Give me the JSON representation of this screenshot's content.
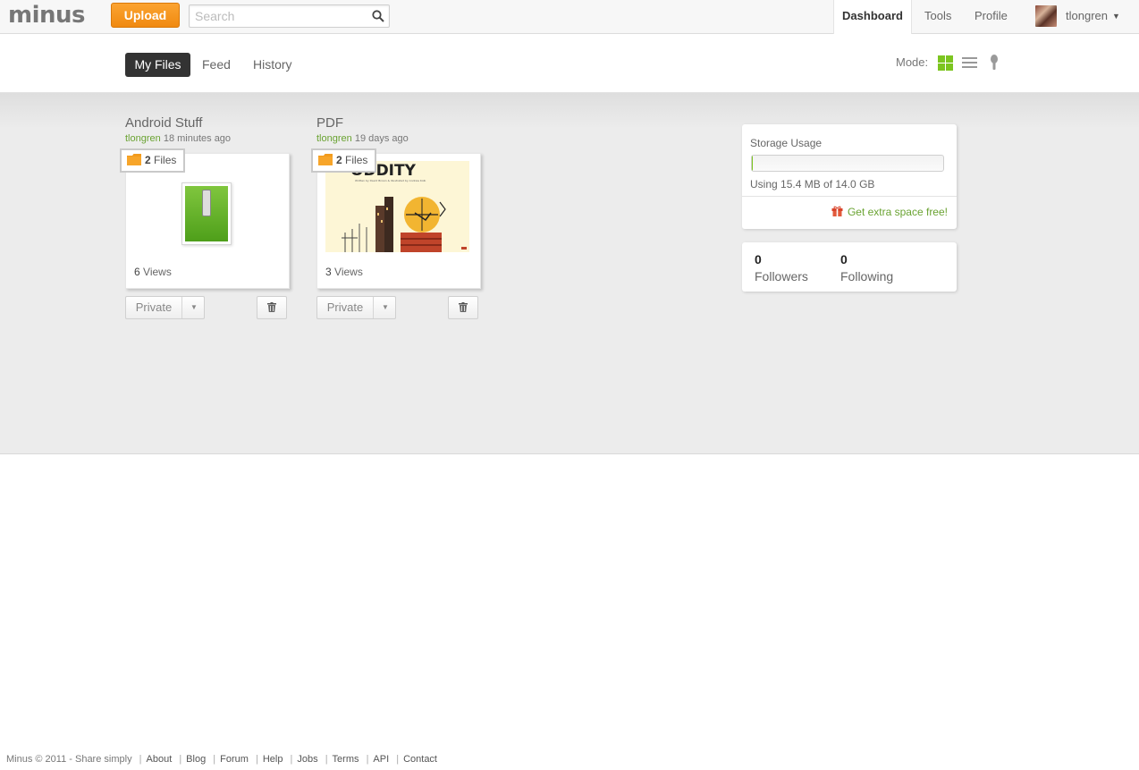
{
  "header": {
    "logo": "minus",
    "upload_label": "Upload",
    "search_placeholder": "Search",
    "nav": {
      "dashboard": "Dashboard",
      "tools": "Tools",
      "profile": "Profile"
    },
    "username": "tlongren"
  },
  "tabs": {
    "my_files": "My Files",
    "feed": "Feed",
    "history": "History"
  },
  "mode": {
    "label": "Mode:",
    "active": "grid",
    "accent": "#7cc520"
  },
  "albums": [
    {
      "title": "Android Stuff",
      "owner": "tlongren",
      "time": "18 minutes ago",
      "file_count": "2",
      "files_label": "Files",
      "views_count": "6",
      "views_label": "Views",
      "privacy": "Private",
      "thumb_icon": "zip-file-icon"
    },
    {
      "title": "PDF",
      "owner": "tlongren",
      "time": "19 days ago",
      "file_count": "2",
      "files_label": "Files",
      "views_count": "3",
      "views_label": "Views",
      "privacy": "Private",
      "thumb_title": "ODDITY",
      "thumb_subtitle": "Written by David Brown & Illustrated by Andrew Kolb",
      "thumb_icon": "pdf-cover-image"
    }
  ],
  "storage": {
    "title": "Storage Usage",
    "used": "15.4 MB",
    "total": "14.0 GB",
    "usage_text": "Using 15.4 MB of 14.0 GB",
    "usage_fraction": 0.001,
    "extra_label": "Get extra space free!"
  },
  "social": {
    "followers_count": "0",
    "followers_label": "Followers",
    "following_count": "0",
    "following_label": "Following"
  },
  "footer": {
    "copyright": "Minus © 2011 - Share simply",
    "links": [
      "About",
      "Blog",
      "Forum",
      "Help",
      "Jobs",
      "Terms",
      "API",
      "Contact"
    ]
  },
  "colors": {
    "brand_orange": "#f08a10",
    "green": "#6aa332",
    "dark_tab": "#333333"
  }
}
